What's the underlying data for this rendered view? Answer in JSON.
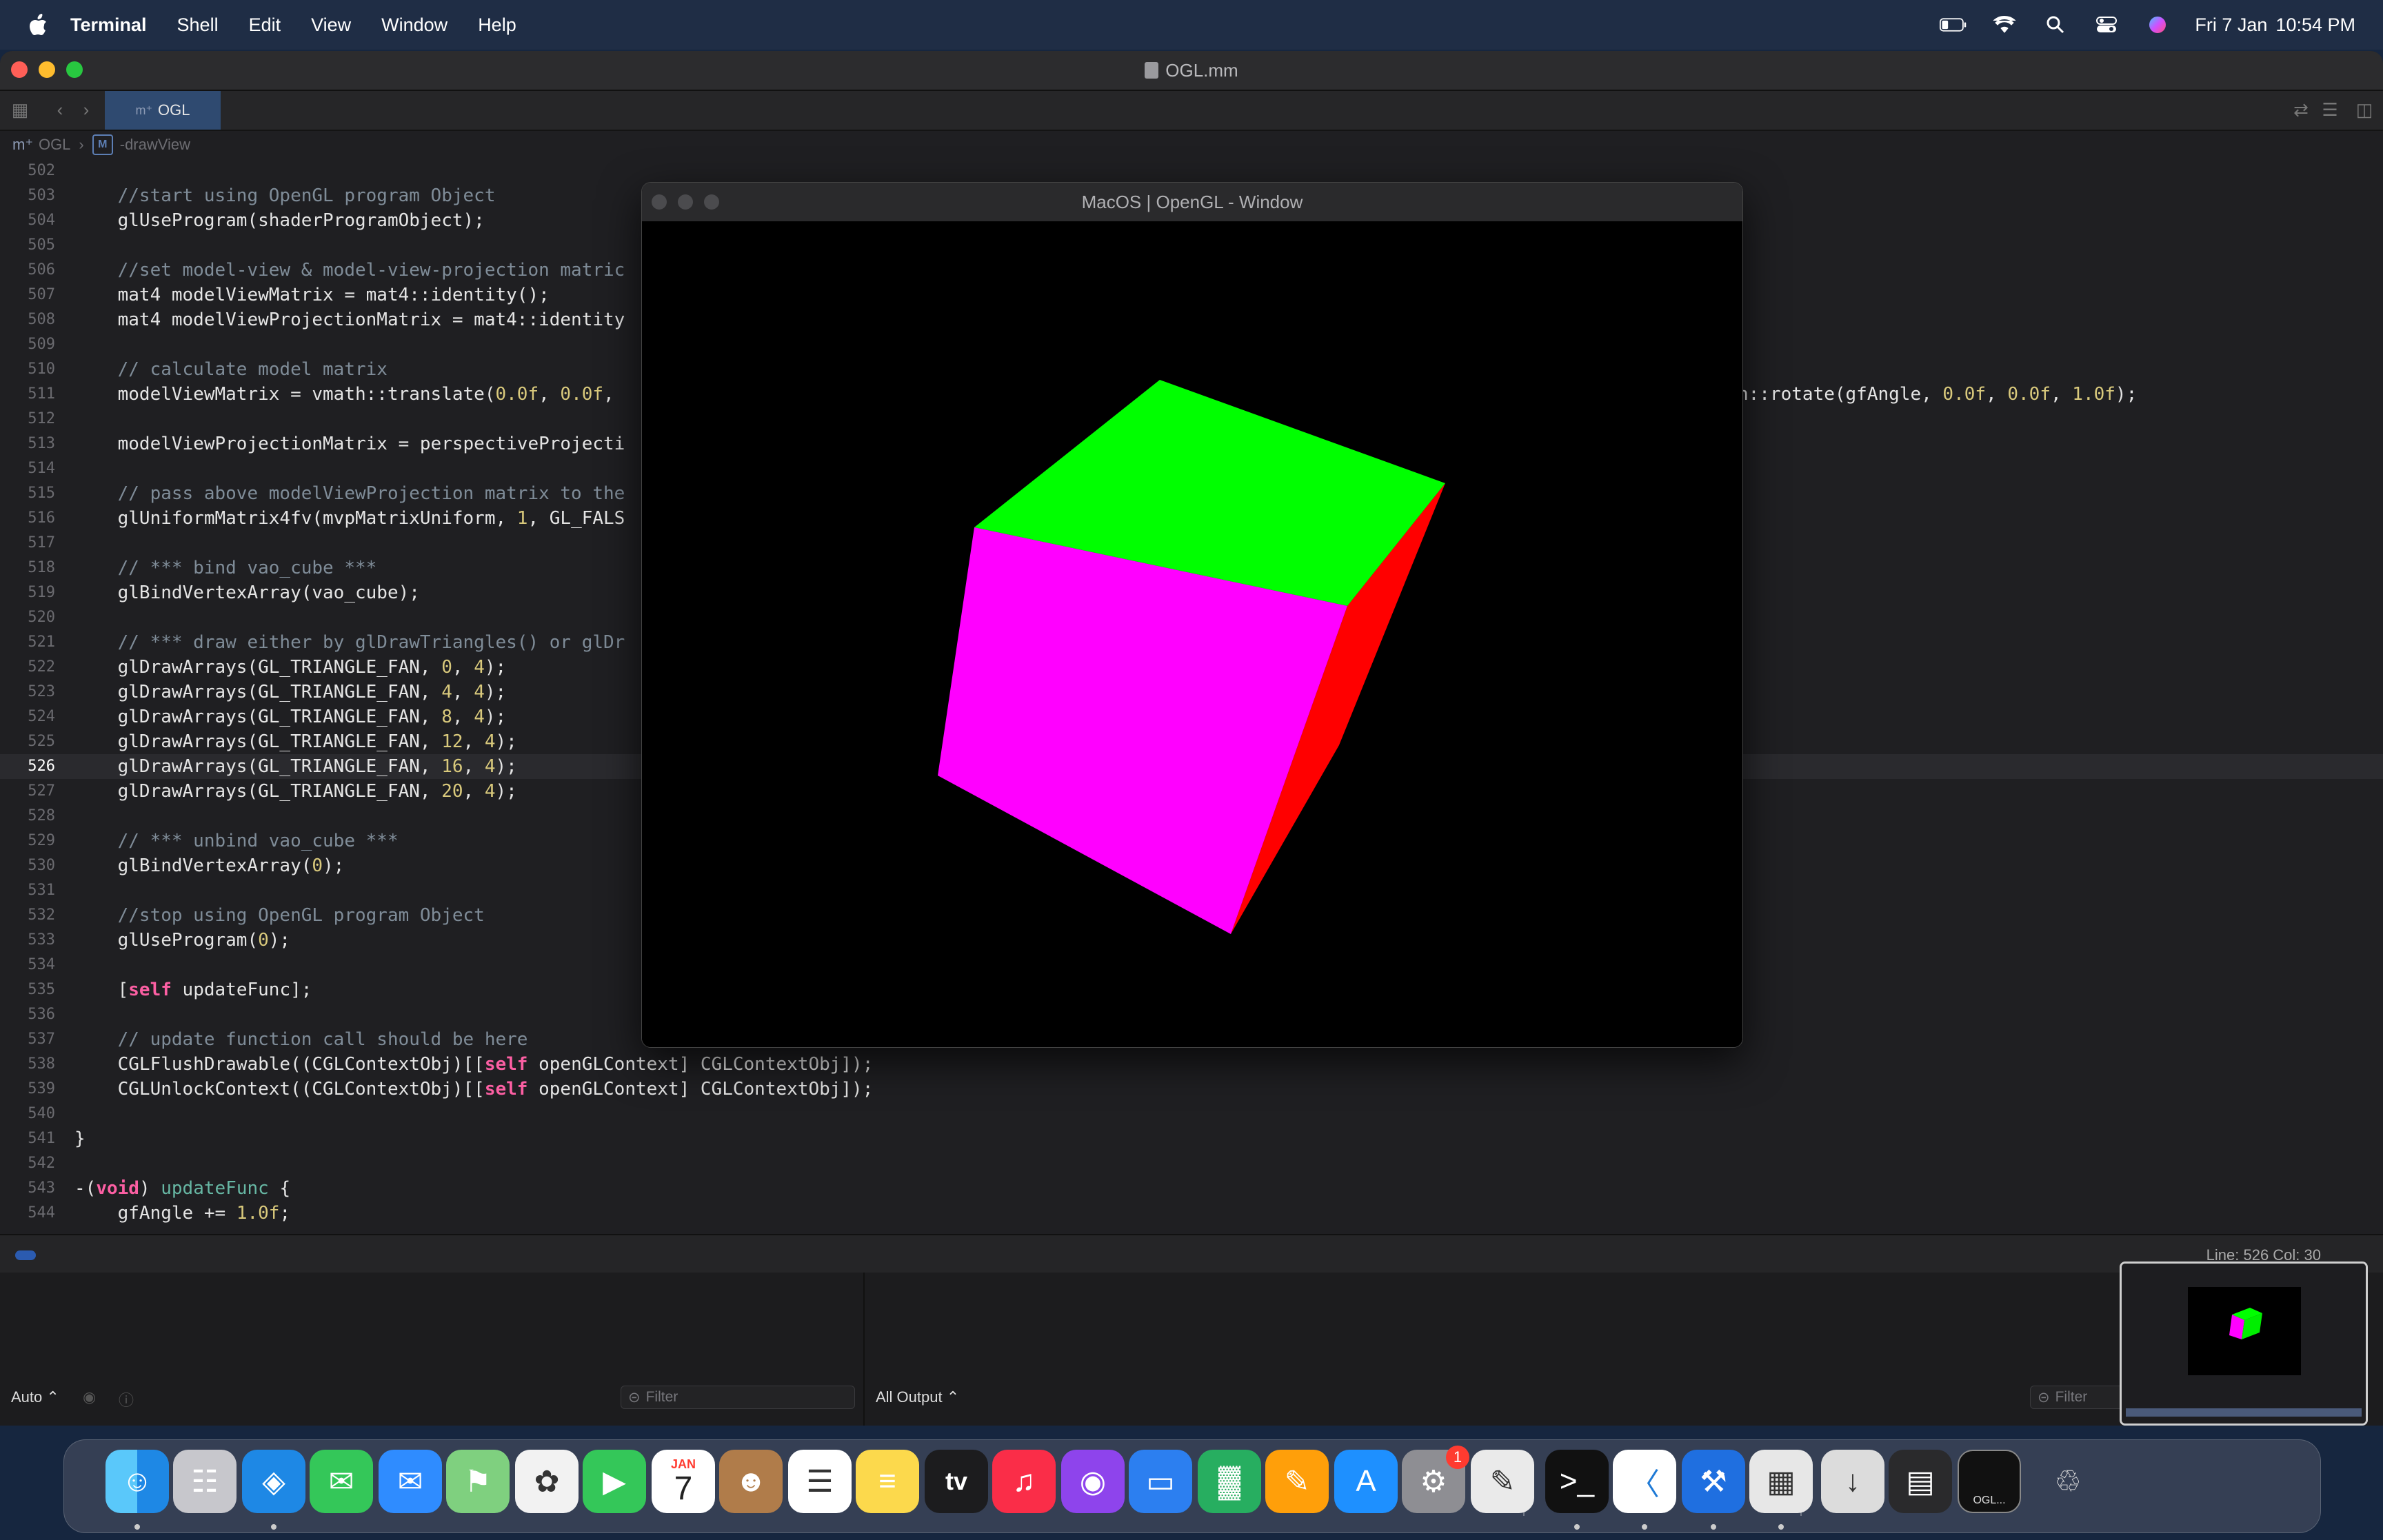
{
  "menubar": {
    "app": "Terminal",
    "menus": [
      "Shell",
      "Edit",
      "View",
      "Window",
      "Help"
    ],
    "date": "Fri 7 Jan",
    "time": "10:54 PM"
  },
  "xcode": {
    "title": "OGL.mm",
    "tab": "OGL",
    "breadcrumb": {
      "file": "OGL",
      "method_badge": "M",
      "method": "-drawView"
    },
    "status": "Line: 526  Col: 30",
    "debug": {
      "left_popup": "Auto ⌃",
      "right_popup": "All Output ⌃",
      "filter_placeholder": "Filter"
    }
  },
  "code": {
    "current_line": 526,
    "lines": [
      {
        "n": "502",
        "t": ""
      },
      {
        "n": "503",
        "t": "    //start using OpenGL program Object"
      },
      {
        "n": "504",
        "t": "    glUseProgram(shaderProgramObject);"
      },
      {
        "n": "505",
        "t": ""
      },
      {
        "n": "506",
        "t": "    //set model-view & model-view-projection matric"
      },
      {
        "n": "507",
        "t": "    mat4 modelViewMatrix = mat4::identity();"
      },
      {
        "n": "508",
        "t": "    mat4 modelViewProjectionMatrix = mat4::identity"
      },
      {
        "n": "509",
        "t": ""
      },
      {
        "n": "510",
        "t": "    // calculate model matrix"
      },
      {
        "n": "511",
        "t": "    modelViewMatrix = vmath::translate(0.0f, 0.0f,"
      },
      {
        "n": "512",
        "t": ""
      },
      {
        "n": "513",
        "t": "    modelViewProjectionMatrix = perspectiveProjecti"
      },
      {
        "n": "514",
        "t": ""
      },
      {
        "n": "515",
        "t": "    // pass above modelViewProjection matrix to the"
      },
      {
        "n": "516",
        "t": "    glUniformMatrix4fv(mvpMatrixUniform, 1, GL_FALS"
      },
      {
        "n": "517",
        "t": ""
      },
      {
        "n": "518",
        "t": "    // *** bind vao_cube ***"
      },
      {
        "n": "519",
        "t": "    glBindVertexArray(vao_cube);"
      },
      {
        "n": "520",
        "t": ""
      },
      {
        "n": "521",
        "t": "    // *** draw either by glDrawTriangles() or glDr"
      },
      {
        "n": "522",
        "t": "    glDrawArrays(GL_TRIANGLE_FAN, 0, 4);"
      },
      {
        "n": "523",
        "t": "    glDrawArrays(GL_TRIANGLE_FAN, 4, 4);"
      },
      {
        "n": "524",
        "t": "    glDrawArrays(GL_TRIANGLE_FAN, 8, 4);"
      },
      {
        "n": "525",
        "t": "    glDrawArrays(GL_TRIANGLE_FAN, 12, 4);"
      },
      {
        "n": "526",
        "t": "    glDrawArrays(GL_TRIANGLE_FAN, 16, 4);"
      },
      {
        "n": "527",
        "t": "    glDrawArrays(GL_TRIANGLE_FAN, 20, 4);"
      },
      {
        "n": "528",
        "t": ""
      },
      {
        "n": "529",
        "t": "    // *** unbind vao_cube ***"
      },
      {
        "n": "530",
        "t": "    glBindVertexArray(0);"
      },
      {
        "n": "531",
        "t": ""
      },
      {
        "n": "532",
        "t": "    //stop using OpenGL program Object"
      },
      {
        "n": "533",
        "t": "    glUseProgram(0);"
      },
      {
        "n": "534",
        "t": ""
      },
      {
        "n": "535",
        "t": "    [self updateFunc];"
      },
      {
        "n": "536",
        "t": ""
      },
      {
        "n": "537",
        "t": "    // update function call should be here"
      },
      {
        "n": "538",
        "t": "    CGLFlushDrawable((CGLContextObj)[[self openGLContext] CGLContextObj]);"
      },
      {
        "n": "539",
        "t": "    CGLUnlockContext((CGLContextObj)[[self openGLContext] CGLContextObj]);"
      },
      {
        "n": "540",
        "t": ""
      },
      {
        "n": "541",
        "t": "}"
      },
      {
        "n": "542",
        "t": ""
      },
      {
        "n": "543",
        "t": "-(void) updateFunc {"
      },
      {
        "n": "544",
        "t": "    gfAngle += 1.0f;"
      }
    ],
    "line_511_tail": "h::rotate(gfAngle, 0.0f, 0.0f, 1.0f);"
  },
  "gl_window": {
    "title": "MacOS | OpenGL - Window",
    "face_colors": {
      "top": "#00ff00",
      "front": "#ff00ff",
      "side": "#ff0000"
    }
  },
  "dock": {
    "apps": [
      {
        "name": "Finder",
        "icon": "finder-icon",
        "running": true
      },
      {
        "name": "Launchpad",
        "icon": "launchpad-icon",
        "running": false
      },
      {
        "name": "Safari",
        "icon": "safari-icon",
        "running": true
      },
      {
        "name": "Messages",
        "icon": "messages-icon",
        "running": false
      },
      {
        "name": "Mail",
        "icon": "mail-icon",
        "running": false
      },
      {
        "name": "Maps",
        "icon": "maps-icon",
        "running": false
      },
      {
        "name": "Photos",
        "icon": "photos-icon",
        "running": false
      },
      {
        "name": "FaceTime",
        "icon": "facetime-icon",
        "running": false
      },
      {
        "name": "Calendar",
        "icon": "calendar-icon",
        "running": false,
        "month": "JAN",
        "day": "7"
      },
      {
        "name": "Contacts",
        "icon": "contacts-icon",
        "running": false
      },
      {
        "name": "Reminders",
        "icon": "reminders-icon",
        "running": false
      },
      {
        "name": "Notes",
        "icon": "notes-icon",
        "running": false
      },
      {
        "name": "TV",
        "icon": "tv-icon",
        "running": false,
        "label": "tv"
      },
      {
        "name": "Music",
        "icon": "music-icon",
        "running": false
      },
      {
        "name": "Podcasts",
        "icon": "podcasts-icon",
        "running": false
      },
      {
        "name": "Keynote",
        "icon": "keynote-icon",
        "running": false
      },
      {
        "name": "Numbers",
        "icon": "numbers-icon",
        "running": false
      },
      {
        "name": "Pages",
        "icon": "pages-icon",
        "running": false
      },
      {
        "name": "App Store",
        "icon": "app-store-icon",
        "running": false
      },
      {
        "name": "System Preferences",
        "icon": "system-preferences-icon",
        "running": false,
        "badge": "1"
      },
      {
        "name": "Script Editor",
        "icon": "script-editor-icon",
        "running": false
      },
      {
        "name": "Terminal",
        "icon": "terminal-icon",
        "running": true
      },
      {
        "name": "Visual Studio Code",
        "icon": "vscode-icon",
        "running": true
      },
      {
        "name": "Xcode",
        "icon": "xcode-icon",
        "running": true
      },
      {
        "name": "Preview",
        "icon": "preview-icon",
        "running": true
      },
      {
        "name": "Downloads",
        "icon": "downloads-icon",
        "running": false
      },
      {
        "name": "Minimized",
        "icon": "minimized-window-icon",
        "running": false
      },
      {
        "name": "OGL",
        "icon": "ogl-window-icon",
        "running": false,
        "label": "OGL..."
      },
      {
        "name": "Trash",
        "icon": "trash-icon",
        "running": false
      }
    ]
  },
  "colors": {
    "accent": "#2f4a70",
    "badge": "#ff3b30",
    "keyword": "#fc5fa3",
    "number": "#d9c97c",
    "comment": "#7f8c98"
  }
}
